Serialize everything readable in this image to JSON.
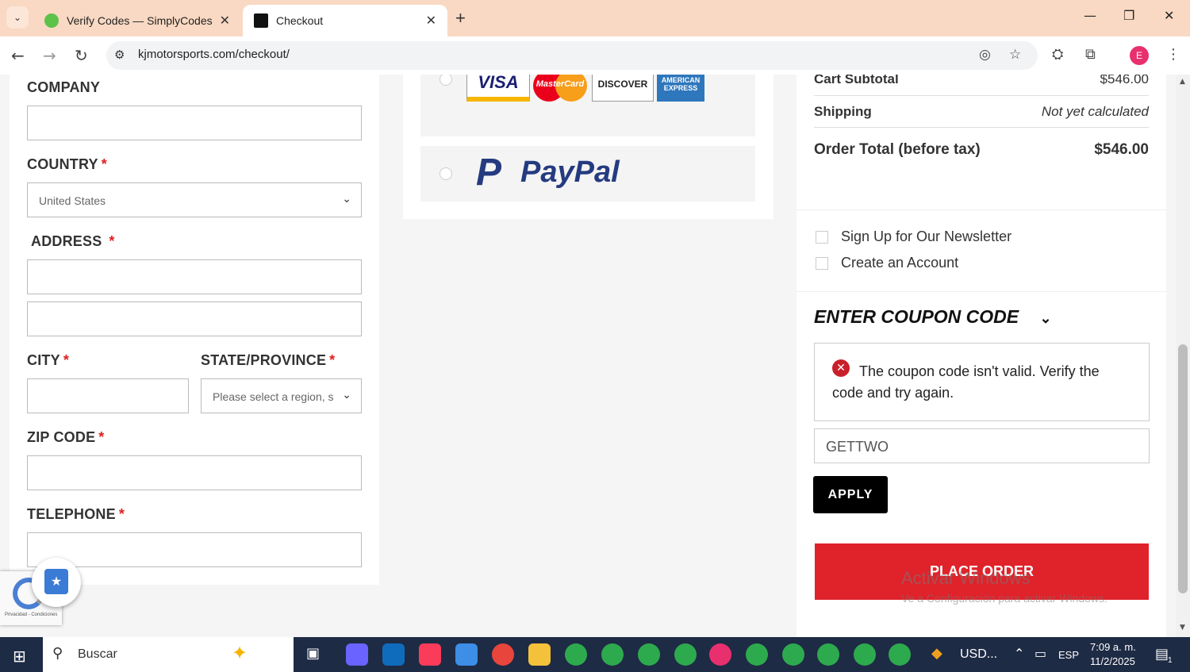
{
  "browser": {
    "tabs": [
      {
        "title": "Verify Codes — SimplyCodes",
        "active": false
      },
      {
        "title": "Checkout",
        "active": true
      }
    ],
    "url": "kjmotorsports.com/checkout/",
    "profile_initial": "E"
  },
  "form": {
    "company_label": "COMPANY",
    "country_label": "COUNTRY",
    "country_value": "United States",
    "address_label": "ADDRESS",
    "city_label": "CITY",
    "state_label": "STATE/PROVINCE",
    "state_placeholder": "Please select a region, s",
    "zip_label": "ZIP CODE",
    "telephone_label": "TELEPHONE",
    "required_mark": "*"
  },
  "payment": {
    "cards": [
      "VISA",
      "MasterCard",
      "DISCOVER",
      "AMERICAN EXPRESS"
    ],
    "paypal": "PayPal"
  },
  "summary": {
    "cart_subtotal_label": "Cart Subtotal",
    "cart_subtotal_value": "$546.00",
    "shipping_label": "Shipping",
    "shipping_value": "Not yet calculated",
    "order_total_label": "Order Total (before tax)",
    "order_total_value": "$546.00",
    "newsletter_label": "Sign Up for Our Newsletter",
    "create_account_label": "Create an Account",
    "coupon_heading": "ENTER COUPON CODE",
    "coupon_error": "The coupon code isn't valid. Verify the code and try again.",
    "coupon_value": "GETTWO",
    "apply_label": "APPLY",
    "place_order_label": "PLACE ORDER"
  },
  "watermark": {
    "line1": "Activar Windows",
    "line2": "Ve a Configuración para activar Windows."
  },
  "recaptcha": {
    "text": "Privacidad - Condiciones"
  },
  "taskbar": {
    "search_label": "Buscar",
    "weather_label": "USD...",
    "language": "ESP",
    "time": "7:09 a. m.",
    "date": "11/2/2025",
    "notification_count": "1"
  },
  "colors": {
    "tabstrip": "#f9d9c3",
    "place_order": "#e0222a",
    "paypal_dark": "#253b80",
    "paypal_light": "#179bd7",
    "taskbar": "#1e2b45"
  }
}
